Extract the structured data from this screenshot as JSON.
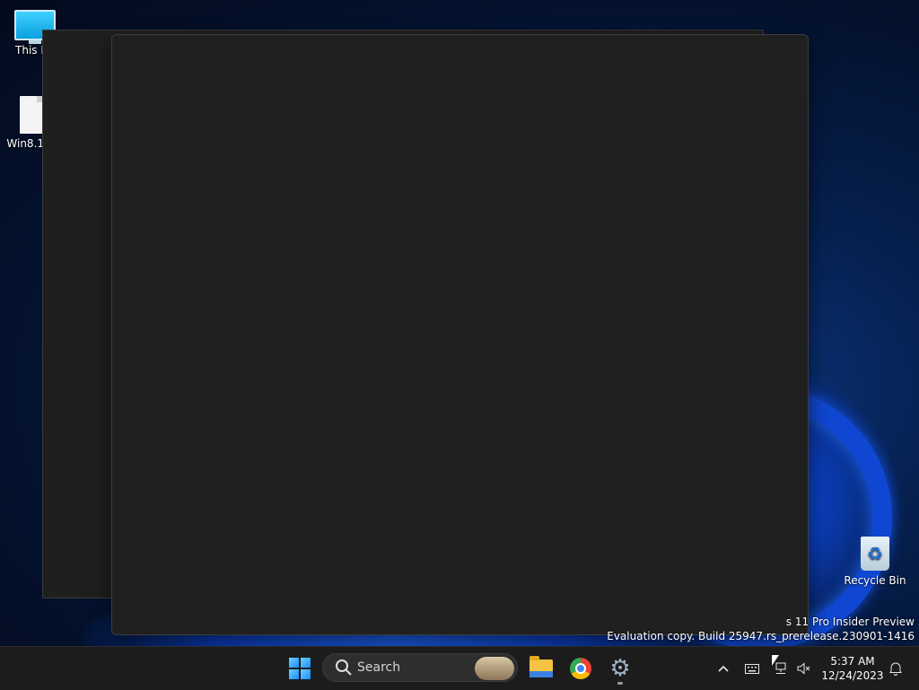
{
  "desktop": {
    "icons": [
      {
        "label": "This PC",
        "icon": "computer-icon"
      },
      {
        "label": "Win8.1_E",
        "icon": "document-icon"
      },
      {
        "label": "Recycle Bin",
        "icon": "recycle-bin-icon"
      }
    ],
    "watermark": {
      "line1": "s 11 Pro Insider Preview",
      "line2": "Evaluation copy. Build 25947.rs_prerelease.230901-1416"
    }
  },
  "taskbar": {
    "search_placeholder": "Search",
    "pinned": [
      {
        "name": "start",
        "icon": "windows-logo-icon"
      },
      {
        "name": "file-explorer",
        "icon": "folder-icon"
      },
      {
        "name": "chrome",
        "icon": "chrome-icon"
      },
      {
        "name": "settings",
        "icon": "gear-icon",
        "running": true
      }
    ],
    "tray": {
      "overflow_glyph": "^",
      "keyboard_glyph": "⌨",
      "network_glyph": "🖧",
      "volume_glyph": "🔇",
      "notification_glyph": "🔔"
    },
    "clock": {
      "time": "5:37 AM",
      "date": "12/24/2023"
    }
  },
  "colors": {
    "window_bg": "#202020",
    "taskbar_bg": "#1c1c1c",
    "accent": "#1c8bff"
  }
}
